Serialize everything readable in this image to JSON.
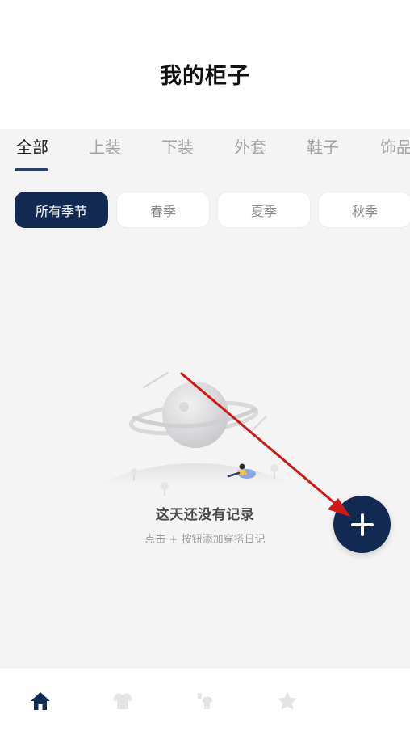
{
  "header": {
    "title": "我的柜子"
  },
  "tabs": [
    {
      "label": "全部",
      "active": true
    },
    {
      "label": "上装"
    },
    {
      "label": "下装"
    },
    {
      "label": "外套"
    },
    {
      "label": "鞋子"
    },
    {
      "label": "饰品"
    }
  ],
  "seasons": [
    {
      "label": "所有季节",
      "active": true
    },
    {
      "label": "春季"
    },
    {
      "label": "夏季"
    },
    {
      "label": "秋季"
    }
  ],
  "empty_state": {
    "title": "这天还没有记录",
    "hint": "点击 + 按钮添加穿搭日记"
  },
  "bottom_nav": [
    {
      "icon": "home-icon",
      "active": true
    },
    {
      "icon": "tshirt-icon"
    },
    {
      "icon": "outfit-icon"
    },
    {
      "icon": "star-icon"
    }
  ],
  "colors": {
    "accent": "#122a52",
    "background": "#f4f4f5",
    "annotation": "#d01818"
  }
}
